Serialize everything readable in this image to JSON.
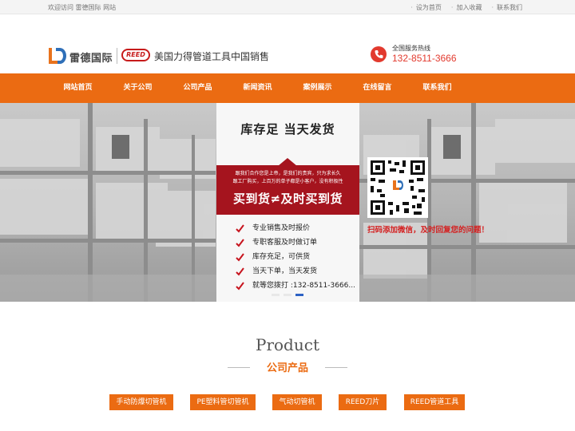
{
  "topbar": {
    "welcome": "欢迎访问 雷德国际 网站",
    "links": [
      "设为首页",
      "加入收藏",
      "联系我们"
    ]
  },
  "header": {
    "logo_name": "雷德国际",
    "reed_badge": "REED",
    "reed_tagline": "美国力得管道工具中国销售",
    "hotline_label": "全国服务热线",
    "hotline_number": "132-8511-3666"
  },
  "nav": {
    "items": [
      "网站首页",
      "关于公司",
      "公司产品",
      "新闻资讯",
      "案例展示",
      "在线留言",
      "联系我们"
    ]
  },
  "banner": {
    "title": "库存足  当天发货",
    "red_lines": [
      "跟我们合作您是上帝，是我们的贵宾，只为求长久",
      "跟工厂购买，上百万的单子都是小客户，没有积极性"
    ],
    "slogan": "买到货≠及时买到货",
    "checklist": [
      "专业销售及时报价",
      "专职客服及时做订单",
      "库存充足，可供货",
      "当天下单，当天发货",
      "就等您拨打 :132-8511-3666..."
    ],
    "qr_caption": "扫码添加微信，及时回复您的问题！",
    "slide_count": 3,
    "active_slide": 3
  },
  "products": {
    "heading_en": "Product",
    "heading_zh": "公司产品",
    "categories": [
      "手动防爆切管机",
      "PE塑料管切管机",
      "气动切管机",
      "REED刀片",
      "REED管道工具"
    ]
  },
  "colors": {
    "accent_orange": "#eb6b12",
    "brand_red": "#a5141e",
    "hotline_red": "#e23a2e"
  }
}
